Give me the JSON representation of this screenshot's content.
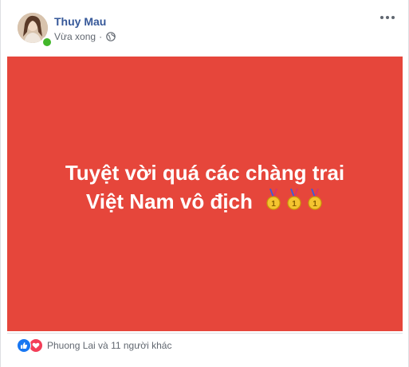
{
  "post": {
    "author": "Thuy Mau",
    "time": "Vừa xong",
    "separator": "·",
    "privacy_icon": "globe-icon",
    "more_icon": "more-options-icon",
    "text_line1": "Tuyệt vời quá các chàng trai",
    "text_line2": "Việt Nam vô địch",
    "medal_icons": [
      "medal-icon",
      "medal-icon",
      "medal-icon"
    ],
    "background_color": "#e6463b",
    "text_color": "#ffffff"
  },
  "reactions": {
    "icons": [
      "like-icon",
      "love-icon"
    ],
    "summary": "Phuong Lai và 11 người khác"
  },
  "colors": {
    "author_link": "#365899",
    "online": "#42b72a",
    "like": "#1877f2",
    "love": "#f33e58"
  }
}
